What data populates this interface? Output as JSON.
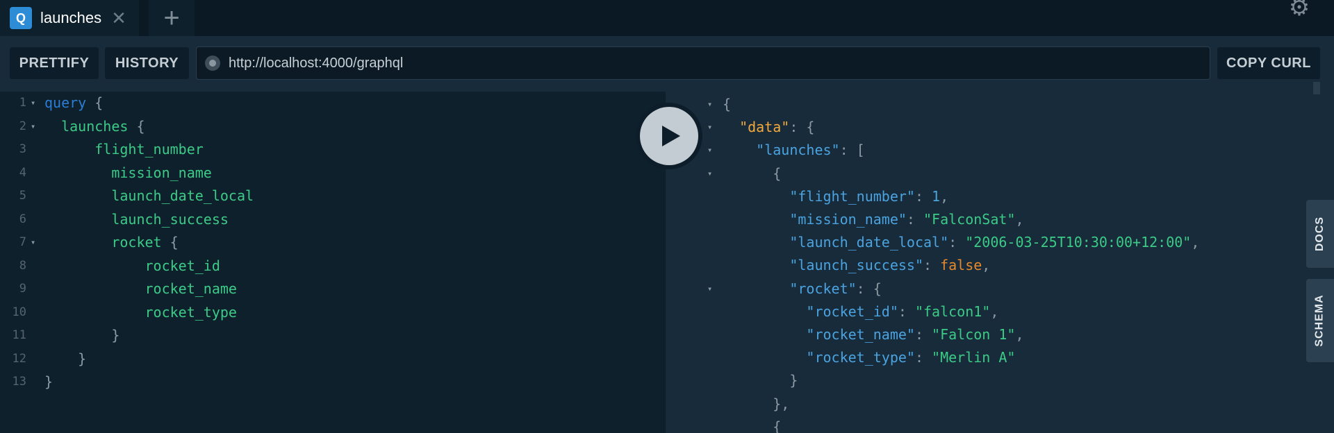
{
  "tab": {
    "badge": "Q",
    "title": "launches",
    "close_symbol": "✕",
    "add_symbol": "+"
  },
  "toolbar": {
    "prettify_label": "PRETTIFY",
    "history_label": "HISTORY",
    "url": "http://localhost:4000/graphql",
    "copy_curl_label": "COPY CURL"
  },
  "side_tabs": {
    "docs": "DOCS",
    "schema": "SCHEMA"
  },
  "colors": {
    "accent": "#2d8cd6",
    "keyword": "#2a7ed3",
    "field": "#3ccb87",
    "json_key": "#4ba3e0",
    "data_key": "#f2a93d",
    "boolean": "#e4892e"
  },
  "editor": {
    "lines": [
      {
        "n": "1",
        "fold": true,
        "parts": [
          [
            "kw",
            "query"
          ],
          [
            "pun",
            " {"
          ]
        ]
      },
      {
        "n": "2",
        "fold": true,
        "parts": [
          [
            "fld",
            "  launches"
          ],
          [
            "pun",
            " {"
          ]
        ]
      },
      {
        "n": "3",
        "fold": false,
        "parts": [
          [
            "fld",
            "      flight_number"
          ]
        ]
      },
      {
        "n": "4",
        "fold": false,
        "parts": [
          [
            "fld",
            "        mission_name"
          ]
        ]
      },
      {
        "n": "5",
        "fold": false,
        "parts": [
          [
            "fld",
            "        launch_date_local"
          ]
        ]
      },
      {
        "n": "6",
        "fold": false,
        "parts": [
          [
            "fld",
            "        launch_success"
          ]
        ]
      },
      {
        "n": "7",
        "fold": true,
        "parts": [
          [
            "fld",
            "        rocket"
          ],
          [
            "pun",
            " {"
          ]
        ]
      },
      {
        "n": "8",
        "fold": false,
        "parts": [
          [
            "fld",
            "            rocket_id"
          ]
        ]
      },
      {
        "n": "9",
        "fold": false,
        "parts": [
          [
            "fld",
            "            rocket_name"
          ]
        ]
      },
      {
        "n": "10",
        "fold": false,
        "parts": [
          [
            "fld",
            "            rocket_type"
          ]
        ]
      },
      {
        "n": "11",
        "fold": false,
        "parts": [
          [
            "pun",
            "        }"
          ]
        ]
      },
      {
        "n": "12",
        "fold": false,
        "parts": [
          [
            "pun",
            "    }"
          ]
        ]
      },
      {
        "n": "13",
        "fold": false,
        "parts": [
          [
            "pun",
            "}"
          ]
        ]
      }
    ]
  },
  "results": {
    "lines": [
      {
        "fold": true,
        "parts": [
          [
            "pun",
            "{"
          ]
        ]
      },
      {
        "fold": true,
        "parts": [
          [
            "dkey",
            "  \"data\""
          ],
          [
            "pun",
            ": {"
          ]
        ]
      },
      {
        "fold": true,
        "parts": [
          [
            "key",
            "    \"launches\""
          ],
          [
            "pun",
            ": ["
          ]
        ]
      },
      {
        "fold": true,
        "parts": [
          [
            "pun",
            "      {"
          ]
        ]
      },
      {
        "fold": false,
        "parts": [
          [
            "key",
            "        \"flight_number\""
          ],
          [
            "pun",
            ": "
          ],
          [
            "num",
            "1"
          ],
          [
            "pun",
            ","
          ]
        ]
      },
      {
        "fold": false,
        "parts": [
          [
            "key",
            "        \"mission_name\""
          ],
          [
            "pun",
            ": "
          ],
          [
            "str",
            "\"FalconSat\""
          ],
          [
            "pun",
            ","
          ]
        ]
      },
      {
        "fold": false,
        "parts": [
          [
            "key",
            "        \"launch_date_local\""
          ],
          [
            "pun",
            ": "
          ],
          [
            "str",
            "\"2006-03-25T10:30:00+12:00\""
          ],
          [
            "pun",
            ","
          ]
        ]
      },
      {
        "fold": false,
        "parts": [
          [
            "key",
            "        \"launch_success\""
          ],
          [
            "pun",
            ": "
          ],
          [
            "bool",
            "false"
          ],
          [
            "pun",
            ","
          ]
        ]
      },
      {
        "fold": true,
        "parts": [
          [
            "key",
            "        \"rocket\""
          ],
          [
            "pun",
            ": {"
          ]
        ]
      },
      {
        "fold": false,
        "parts": [
          [
            "key",
            "          \"rocket_id\""
          ],
          [
            "pun",
            ": "
          ],
          [
            "str",
            "\"falcon1\""
          ],
          [
            "pun",
            ","
          ]
        ]
      },
      {
        "fold": false,
        "parts": [
          [
            "key",
            "          \"rocket_name\""
          ],
          [
            "pun",
            ": "
          ],
          [
            "str",
            "\"Falcon 1\""
          ],
          [
            "pun",
            ","
          ]
        ]
      },
      {
        "fold": false,
        "parts": [
          [
            "key",
            "          \"rocket_type\""
          ],
          [
            "pun",
            ": "
          ],
          [
            "str",
            "\"Merlin A\""
          ]
        ]
      },
      {
        "fold": false,
        "parts": [
          [
            "pun",
            "        }"
          ]
        ]
      },
      {
        "fold": false,
        "parts": [
          [
            "pun",
            "      },"
          ]
        ]
      },
      {
        "fold": false,
        "parts": [
          [
            "pun",
            "      {"
          ]
        ]
      }
    ]
  }
}
